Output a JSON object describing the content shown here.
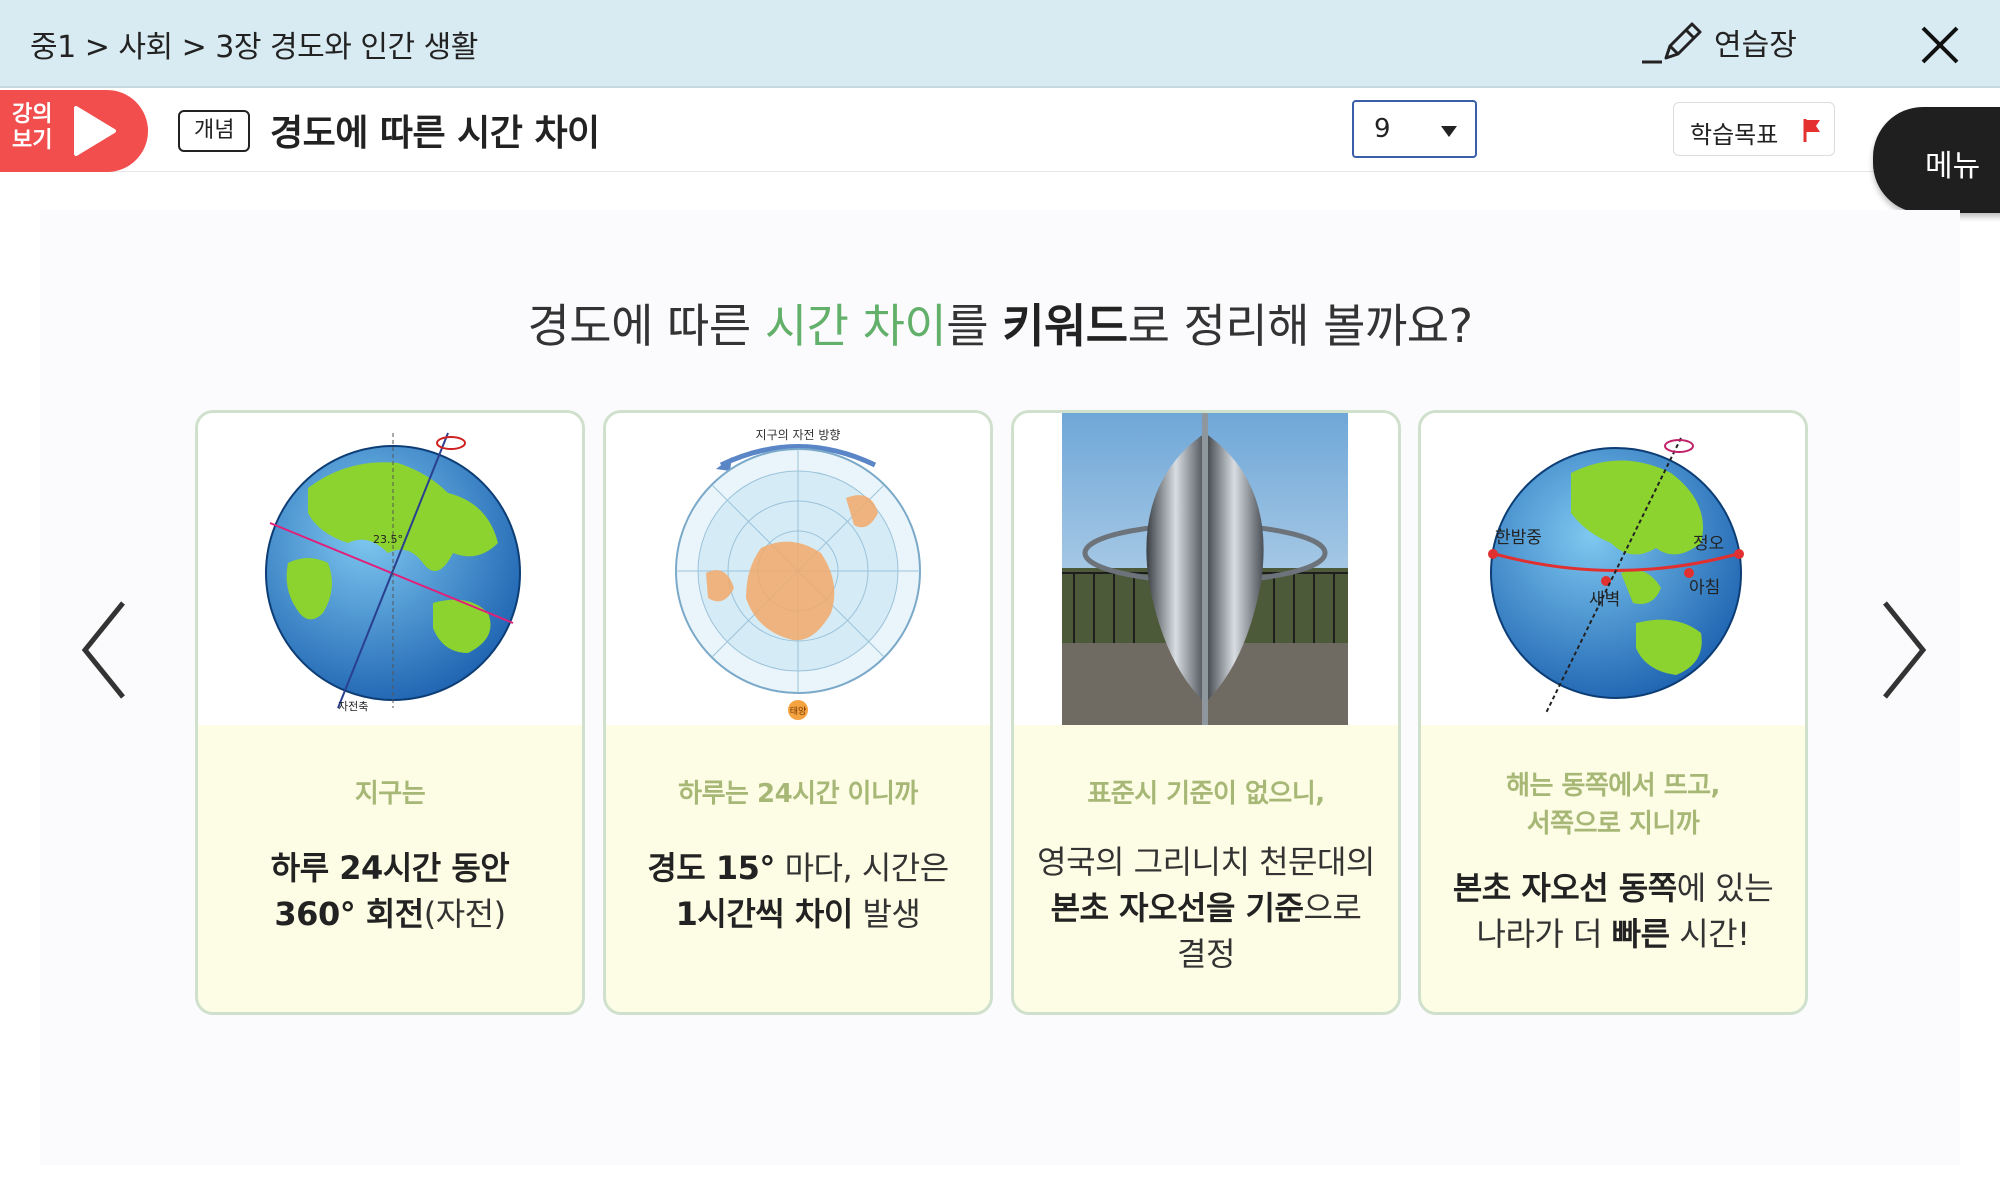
{
  "breadcrumb": "중1 > 사회 > 3장 경도와 인간 생활",
  "practice_label": "연습장",
  "lecture_label": "강의 보기",
  "concept_badge": "개념",
  "lesson_title": "경도에 따른 시간 차이",
  "page_select": {
    "value": "9"
  },
  "goal_label": "학습목표",
  "menu_label": "메뉴",
  "headline": {
    "part1": "경도에 따른 ",
    "highlight": "시간 차이",
    "part2": "를 ",
    "bold": "키워드",
    "part3": "로 정리해 볼까요?"
  },
  "cards": [
    {
      "caption": "지구는",
      "line1_bold": "하루 24시간 동안",
      "line2_bold": "360° 회전",
      "line2_rest": "(자전)",
      "img_labels": {
        "tilt": "23.5°",
        "axis": "자전축"
      }
    },
    {
      "caption": "하루는 24시간 이니까",
      "line1_bold": "경도 15°",
      "line1_rest": " 마다, 시간은",
      "line2_bold": "1시간씩 차이",
      "line2_rest": " 발생",
      "img_labels": {
        "top": "지구의 자전 방향",
        "sun": "태양"
      }
    },
    {
      "caption": "표준시 기준이 없으니,",
      "line1": "영국의 그리니치 천문대의",
      "line2_bold": "본초 자오선을 기준",
      "line2_rest": "으로",
      "line3": "결정"
    },
    {
      "caption_line1": "해는 동쪽에서 뜨고,",
      "caption_line2": "서쪽으로 지니까",
      "line1_bold": "본초 자오선 동쪽",
      "line1_rest": "에 있는",
      "line2_pre": "나라가 더 ",
      "line2_bold": "빠른",
      "line2_rest": " 시간!",
      "img_labels": {
        "midnight": "한밤중",
        "noon": "정오",
        "dawn": "새벽",
        "morning": "아침"
      }
    }
  ],
  "colors": {
    "accent_green": "#62b06a",
    "lecture_red": "#f24e4e",
    "topbar": "#d9ebf2"
  }
}
